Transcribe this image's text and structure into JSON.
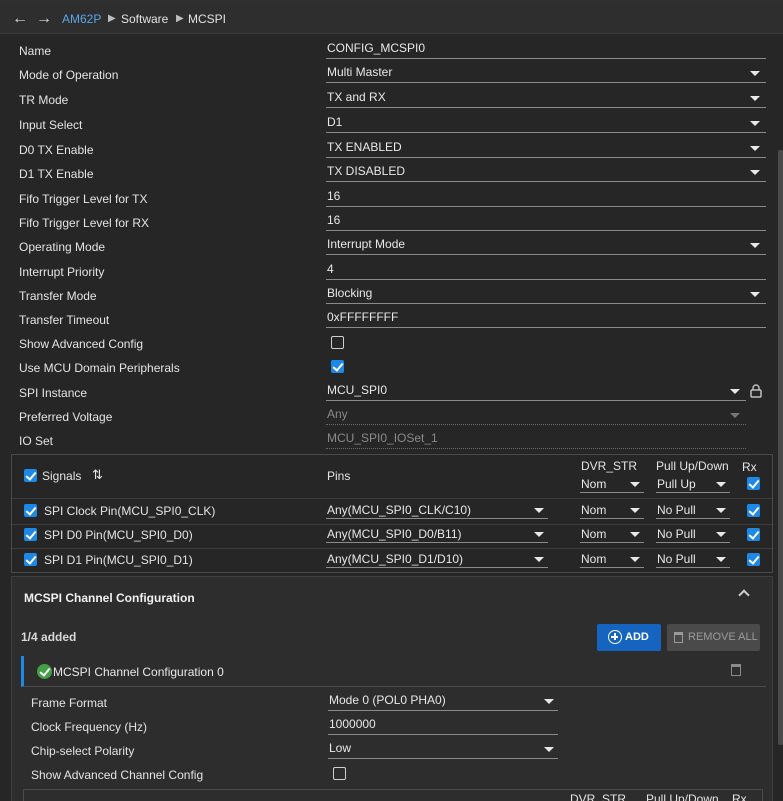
{
  "breadcrumb": [
    "AM62P",
    "Software",
    "MCSPI"
  ],
  "form": [
    {
      "label": "Name",
      "value": "CONFIG_MCSPI0",
      "kind": "text"
    },
    {
      "label": "Mode of Operation",
      "value": "Multi Master",
      "kind": "select"
    },
    {
      "label": "TR Mode",
      "value": "TX and RX",
      "kind": "select"
    },
    {
      "label": "Input Select",
      "value": "D1",
      "kind": "select"
    },
    {
      "label": "D0 TX Enable",
      "value": "TX ENABLED",
      "kind": "select"
    },
    {
      "label": "D1 TX Enable",
      "value": "TX DISABLED",
      "kind": "select"
    },
    {
      "label": "Fifo Trigger Level for TX",
      "value": "16",
      "kind": "text"
    },
    {
      "label": "Fifo Trigger Level for RX",
      "value": "16",
      "kind": "text"
    },
    {
      "label": "Operating Mode",
      "value": "Interrupt Mode",
      "kind": "select"
    },
    {
      "label": "Interrupt Priority",
      "value": "4",
      "kind": "text"
    },
    {
      "label": "Transfer Mode",
      "value": "Blocking",
      "kind": "select"
    },
    {
      "label": "Transfer Timeout",
      "value": "0xFFFFFFFF",
      "kind": "text"
    },
    {
      "label": "Show Advanced Config",
      "checked": false,
      "kind": "check"
    },
    {
      "label": "Use MCU Domain Peripherals",
      "checked": true,
      "kind": "check"
    },
    {
      "label": "SPI Instance",
      "value": "MCU_SPI0",
      "kind": "select-lock"
    },
    {
      "label": "Preferred Voltage",
      "value": "Any",
      "kind": "select-disabled"
    },
    {
      "label": "IO Set",
      "value": "MCU_SPI0_IOSet_1",
      "kind": "text-disabled"
    }
  ],
  "signals": {
    "header": {
      "signals": "Signals",
      "pins": "Pins",
      "dvr": "DVR_STR",
      "pull": "Pull Up/Down",
      "rx": "Rx",
      "dvr_value": "Nom",
      "pull_value": "Pull Up"
    },
    "rows": [
      {
        "name": "SPI Clock Pin(MCU_SPI0_CLK)",
        "pin": "Any(MCU_SPI0_CLK/C10)",
        "dvr": "Nom",
        "pull": "No Pull"
      },
      {
        "name": "SPI D0 Pin(MCU_SPI0_D0)",
        "pin": "Any(MCU_SPI0_D0/B11)",
        "dvr": "Nom",
        "pull": "No Pull"
      },
      {
        "name": "SPI D1 Pin(MCU_SPI0_D1)",
        "pin": "Any(MCU_SPI0_D1/D10)",
        "dvr": "Nom",
        "pull": "No Pull"
      }
    ]
  },
  "channel": {
    "title": "MCSPI Channel Configuration",
    "added": "1/4 added",
    "add_label": "ADD",
    "remove_label": "REMOVE ALL",
    "item_title": "MCSPI Channel Configuration 0",
    "fields": [
      {
        "label": "Frame Format",
        "value": "Mode 0 (POL0 PHA0)",
        "kind": "select"
      },
      {
        "label": "Clock Frequency (Hz)",
        "value": "1000000",
        "kind": "text"
      },
      {
        "label": "Chip-select Polarity",
        "value": "Low",
        "kind": "select"
      },
      {
        "label": "Show Advanced Channel Config",
        "checked": false,
        "kind": "check"
      }
    ],
    "subtable": {
      "dvr": "DVR_STR",
      "pull": "Pull Up/Down",
      "rx": "Rx"
    }
  }
}
